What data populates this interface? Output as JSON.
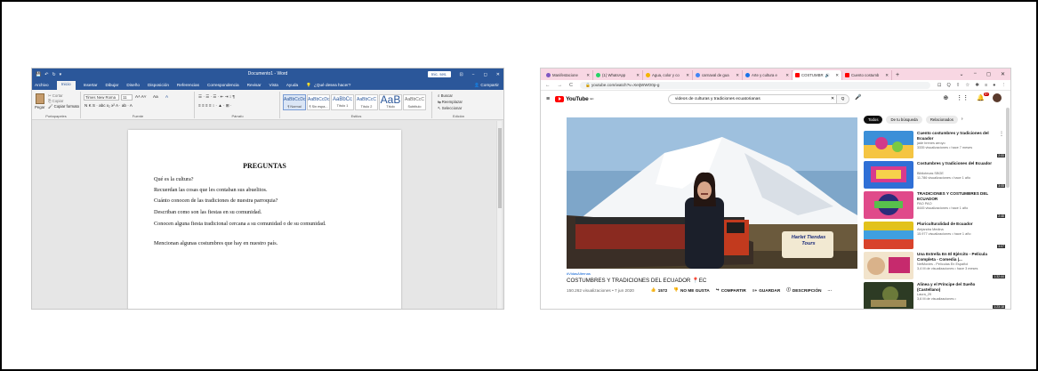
{
  "word": {
    "title_bar": {
      "quick_access": [
        "💾",
        "↶",
        "↻",
        "▾"
      ],
      "document_title": "Documento1 - Word",
      "signin_label": "Inic. ses.",
      "window_controls": [
        "⊡",
        "−",
        "◻",
        "✕"
      ]
    },
    "tabs": [
      "Archivo",
      "Inicio",
      "Insertar",
      "Dibujar",
      "Diseño",
      "Disposición",
      "Referencias",
      "Correspondencia",
      "Revisar",
      "Vista",
      "Ayuda"
    ],
    "active_tab": "Inicio",
    "tell_me": "¿Qué desea hacer?",
    "share": "Compartir",
    "ribbon": {
      "clipboard": {
        "paste": "Pegar",
        "cut": "Cortar",
        "copy": "Copiar",
        "format_painter": "Copiar formato",
        "label": "Portapapeles"
      },
      "font": {
        "name": "Times New Roma",
        "size": "11",
        "grow_shrink": "A˄ A˅",
        "case": "Aa",
        "clear": "A",
        "format_row": "N  K  S  ·  abc  x₂  x²   A  ·  ab  ·  A",
        "label": "Fuente"
      },
      "paragraph": {
        "row1": "☰ ·  ☰ ·  ☰ ·   ⇤ ⇥   ↕   ¶",
        "row2": "≡  ≡  ≡  ≡   ↕ ·   ▲ ·   ⊞ ·",
        "label": "Párrafo"
      },
      "styles": {
        "items": [
          {
            "sample": "AaBbCcDc",
            "name": "¶ Normal"
          },
          {
            "sample": "AaBbCcDc",
            "name": "¶ Sin espa..."
          },
          {
            "sample": "AaBbCc",
            "name": "Título 1"
          },
          {
            "sample": "AaBbCcC",
            "name": "Título 2"
          },
          {
            "sample": "AaB",
            "name": "Título"
          },
          {
            "sample": "AaBbCcC",
            "name": "Subtítulo"
          }
        ],
        "label": "Estilos"
      },
      "editing": {
        "find": "Buscar",
        "replace": "Reemplazar",
        "select": "Seleccionar",
        "label": "Edición"
      }
    },
    "document": {
      "heading": "PREGUNTAS",
      "questions": [
        "Qué es la cultura?",
        "Recuerdan las cosas que les contaban sus abuelitos.",
        "Cuánto conocen de las tradiciones de nuestra parroquia?",
        "Describan como son las fiestas en su comunidad.",
        "Conocen alguna fiesta tradicional cercana a su comunidad o de su comunidad.",
        "Mencionan algunas costumbres que hay en nuestro país."
      ]
    }
  },
  "chrome": {
    "tabs": [
      {
        "label": "Manifestacione",
        "color": "#7e57c2"
      },
      {
        "label": "(1) WhatsApp",
        "color": "#25d366"
      },
      {
        "label": "Agua, color y co",
        "color": "#f4b400"
      },
      {
        "label": "carnaval de gua",
        "color": "#4285f4"
      },
      {
        "label": "Arte y cultura e",
        "color": "#1a73e8"
      },
      {
        "label": "COSTUMBR",
        "color": "#ff0000"
      },
      {
        "label": "Cuento costumb",
        "color": "#ff0000"
      }
    ],
    "active_tab_index": 5,
    "new_tab": "+",
    "window_controls": [
      "⌄",
      "−",
      "◻",
      "✕"
    ],
    "url": "youtube.com/watch?v=XeIjWWO0p-g",
    "nav_icons": [
      "←",
      "→",
      "C"
    ],
    "toolbar_icons": [
      "⊡",
      "Q",
      "⇧",
      "☆",
      "✱",
      "≡",
      "●",
      "⋮"
    ]
  },
  "youtube": {
    "menu_icon": "≡",
    "logo_text": "YouTube",
    "logo_country": "EC",
    "search_query": "videos de culturas y tradiciones ecuatorianas",
    "search_clear": "✕",
    "search_icon": "Q",
    "mic_icon": "🎤",
    "notif_count": "9+",
    "video": {
      "hashtag": "#VidasAlternas",
      "title": "COSTUMBRES Y TRADICIONES DEL ECUADOR 📍EC",
      "views_date": "150.262 visualizaciones • 7 jun 2020",
      "likes": "1572",
      "dislike": "NO ME GUSTA",
      "share": "COMPARTIR",
      "save": "GUARDAR",
      "description": "DESCRIPCIÓN",
      "more": "···",
      "overlay_logo": "Harlet Tiendas Tours"
    },
    "chips": [
      "Todos",
      "De tu búsqueda",
      "Relacionados"
    ],
    "chip_next": "›",
    "related": [
      {
        "title": "Cuento costumbres y tradiciones del Ecuador",
        "channel": "jade brenes arroyo",
        "meta": "3335 visualizaciones • hace 7 meses",
        "duration": "2:00",
        "colors": [
          "#3b8fd8",
          "#f5c542",
          "#d23a8a"
        ]
      },
      {
        "title": "Costumbres y tradiciones del Ecuador",
        "channel": "Bibliotecas SBGE",
        "meta": "11.786 visualizaciones • hace 1 año",
        "duration": "3:05",
        "colors": [
          "#2f6fd6",
          "#d83a8d",
          "#f6d14b"
        ]
      },
      {
        "title": "TRADICIONES Y COSTUMBRES DEL ECUADOR",
        "channel": "PAO PAO",
        "meta": "8445 visualizaciones • hace 1 año",
        "duration": "2:46",
        "colors": [
          "#e04a8a",
          "#2b2b7a",
          "#58c04c"
        ]
      },
      {
        "title": "Pluriculturalidad de Ecuador",
        "channel": "Alejandra Medina",
        "meta": "15.977 visualizaciones • hace 1 año",
        "duration": "3:07",
        "colors": [
          "#e2c21c",
          "#3f9fe0",
          "#d8432c"
        ]
      },
      {
        "title": "Una Estrella En El Ejército - Película Completa - Comedia |...",
        "channel": "NetMovies - Películas En Español",
        "meta": "3,4 M de visualizaciones • hace 3 meses",
        "duration": "1:32:44",
        "colors": [
          "#d9b28a",
          "#c62a6d",
          "#f2e4cc"
        ]
      },
      {
        "title": "Alinea y el Príncipe del Sueño (Castellano)",
        "channel": "Laura_29",
        "meta": "3,6 M de visualizaciones •",
        "duration": "1:23:18",
        "colors": [
          "#2d3b24",
          "#6b7a3a",
          "#9d8a54"
        ]
      }
    ]
  }
}
